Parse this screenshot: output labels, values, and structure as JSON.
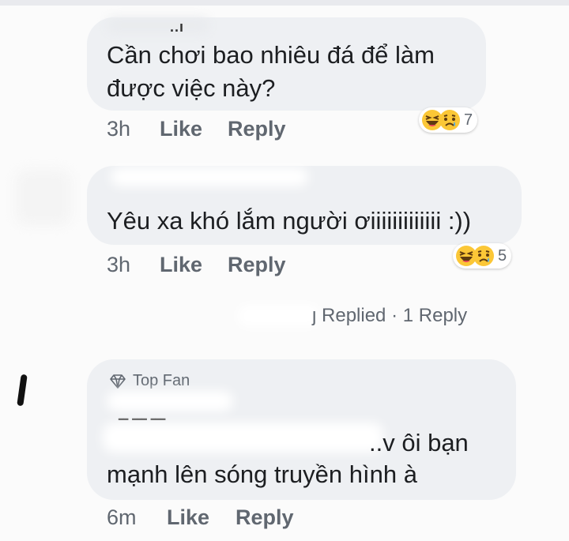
{
  "comments": [
    {
      "text_lines": [
        "Cần chơi bao nhiêu đá để làm",
        "được việc này?"
      ],
      "time": "3h",
      "like": "Like",
      "reply": "Reply",
      "reactions": [
        "haha",
        "sad"
      ],
      "reaction_count": "7"
    },
    {
      "text_lines": [
        "Yêu xa khó lắm người ơiiiiiiiiiiiii :))"
      ],
      "time": "3h",
      "like": "Like",
      "reply": "Reply",
      "reactions": [
        "haha",
        "sad"
      ],
      "reaction_count": "5"
    },
    {
      "badge": "Top Fan",
      "badge_icon": "diamond-icon",
      "text_lines": [
        "..v ôi bạn",
        "mạnh lên sóng truyền hình à"
      ],
      "time": "6m",
      "like": "Like",
      "reply": "Reply"
    }
  ],
  "replies_link": {
    "replied": "Replied",
    "separator": "·",
    "count": "1 Reply"
  },
  "colors": {
    "bubble": "#eef0f3",
    "meta": "#606770",
    "text": "#1c1e21"
  }
}
